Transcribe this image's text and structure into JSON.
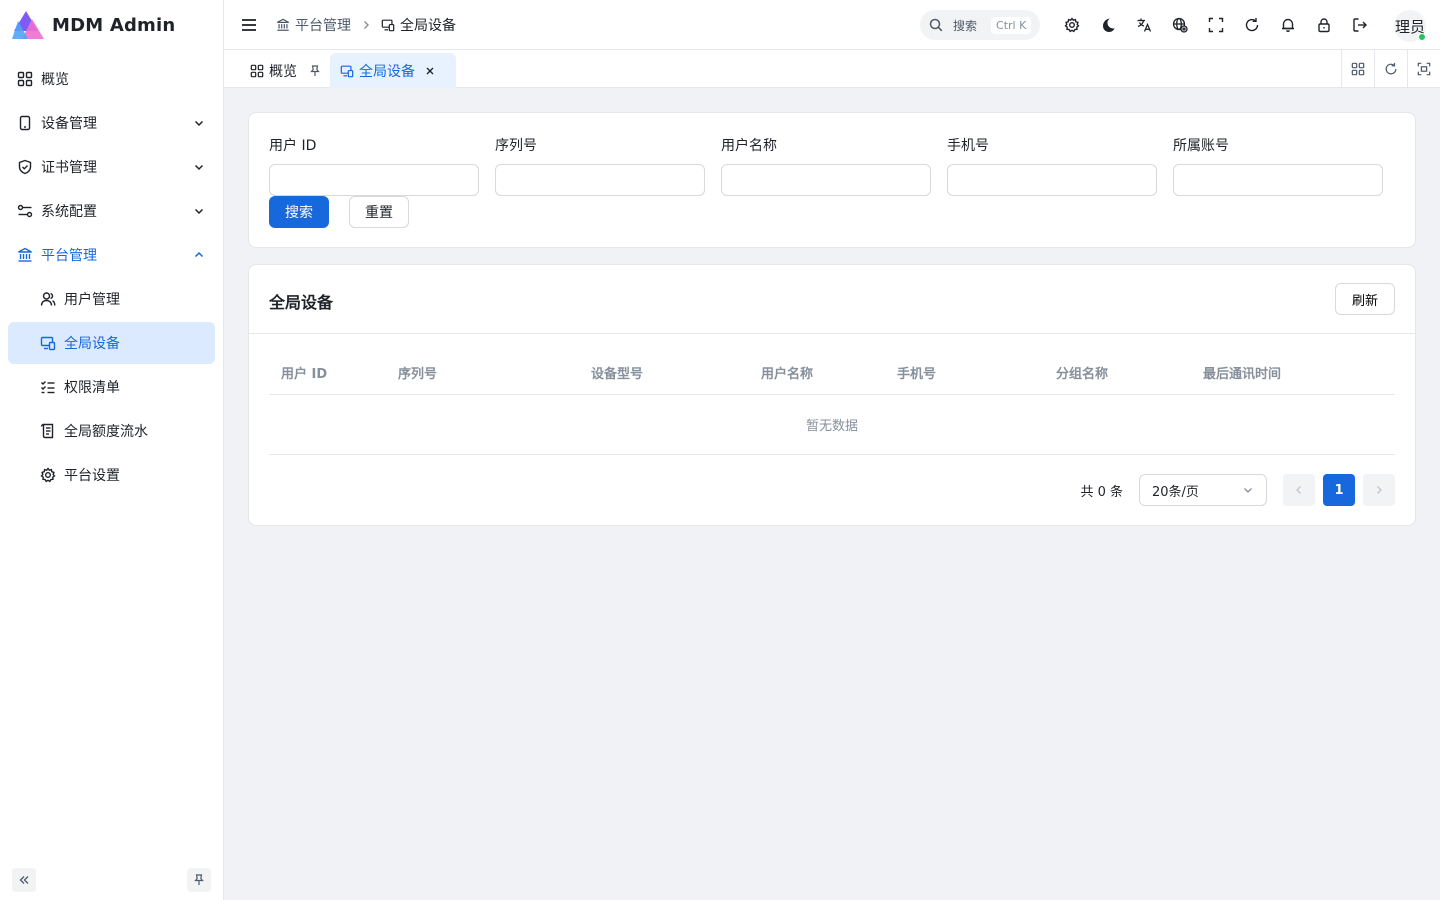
{
  "app": {
    "name": "MDM Admin"
  },
  "sidebar": {
    "items": [
      {
        "label": "概览",
        "icon": "dashboard-icon"
      },
      {
        "label": "设备管理",
        "icon": "device-icon"
      },
      {
        "label": "证书管理",
        "icon": "shield-icon"
      },
      {
        "label": "系统配置",
        "icon": "settings-sliders-icon"
      },
      {
        "label": "平台管理",
        "icon": "bank-icon"
      }
    ],
    "sub_items": [
      {
        "label": "用户管理",
        "icon": "user-icon"
      },
      {
        "label": "全局设备",
        "icon": "devices-icon"
      },
      {
        "label": "权限清单",
        "icon": "checklist-icon"
      },
      {
        "label": "全局额度流水",
        "icon": "ledger-icon"
      },
      {
        "label": "平台设置",
        "icon": "gear-icon"
      }
    ]
  },
  "header": {
    "breadcrumb": [
      "平台管理",
      "全局设备"
    ],
    "search_label": "搜索",
    "search_shortcut": "Ctrl K",
    "avatar_text": "理员"
  },
  "tabs": [
    {
      "label": "概览"
    },
    {
      "label": "全局设备"
    }
  ],
  "filter": {
    "fields": [
      {
        "label": "用户 ID",
        "value": ""
      },
      {
        "label": "序列号",
        "value": ""
      },
      {
        "label": "用户名称",
        "value": ""
      },
      {
        "label": "手机号",
        "value": ""
      },
      {
        "label": "所属账号",
        "value": ""
      }
    ],
    "search_button": "搜索",
    "reset_button": "重置"
  },
  "table": {
    "title": "全局设备",
    "refresh_button": "刷新",
    "columns": [
      "用户 ID",
      "序列号",
      "设备型号",
      "用户名称",
      "手机号",
      "分组名称",
      "最后通讯时间"
    ],
    "rows": [],
    "empty_text": "暂无数据"
  },
  "pagination": {
    "total_text": "共 0 条",
    "page_size": "20条/页",
    "current_page": "1"
  },
  "colors": {
    "primary": "#1668dc",
    "active_bg": "#dbeafe"
  }
}
